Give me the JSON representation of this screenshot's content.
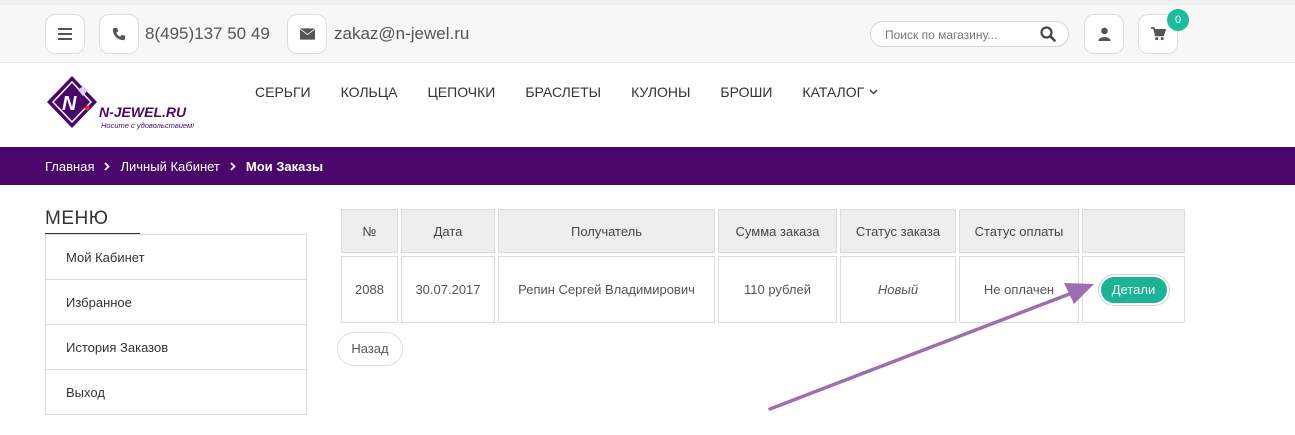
{
  "topbar": {
    "phone": "8(495)137 50 49",
    "email": "zakaz@n-jewel.ru",
    "search_placeholder": "Поиск по магазину...",
    "cart_count": "0"
  },
  "logo": {
    "brand": "N-JEWEL.RU",
    "tagline": "Носите с удовольствием!"
  },
  "nav": {
    "items": [
      "СЕРЬГИ",
      "КОЛЬЦА",
      "ЦЕПОЧКИ",
      "БРАСЛЕТЫ",
      "КУЛОНЫ",
      "БРОШИ",
      "КАТАЛОГ"
    ]
  },
  "breadcrumb": [
    "Главная",
    "Личный Кабинет",
    "Мои Заказы"
  ],
  "menu": {
    "title": "МЕНЮ",
    "items": [
      "Мой Кабинет",
      "Избранное",
      "История Заказов",
      "Выход"
    ]
  },
  "orders": {
    "headers": [
      "№",
      "Дата",
      "Получатель",
      "Сумма заказа",
      "Статус заказа",
      "Статус оплаты",
      ""
    ],
    "rows": [
      {
        "number": "2088",
        "date": "30.07.2017",
        "recipient": "Репин Сергей Владимирович",
        "sum": "110 рублей",
        "order_status": "Новый",
        "payment_status": "Не оплачен",
        "action": "Детали"
      }
    ]
  },
  "back_label": "Назад",
  "colors": {
    "brand_purple": "#4a076a",
    "accent_green": "#1ab394",
    "annotation_arrow": "#9b6fb0"
  }
}
